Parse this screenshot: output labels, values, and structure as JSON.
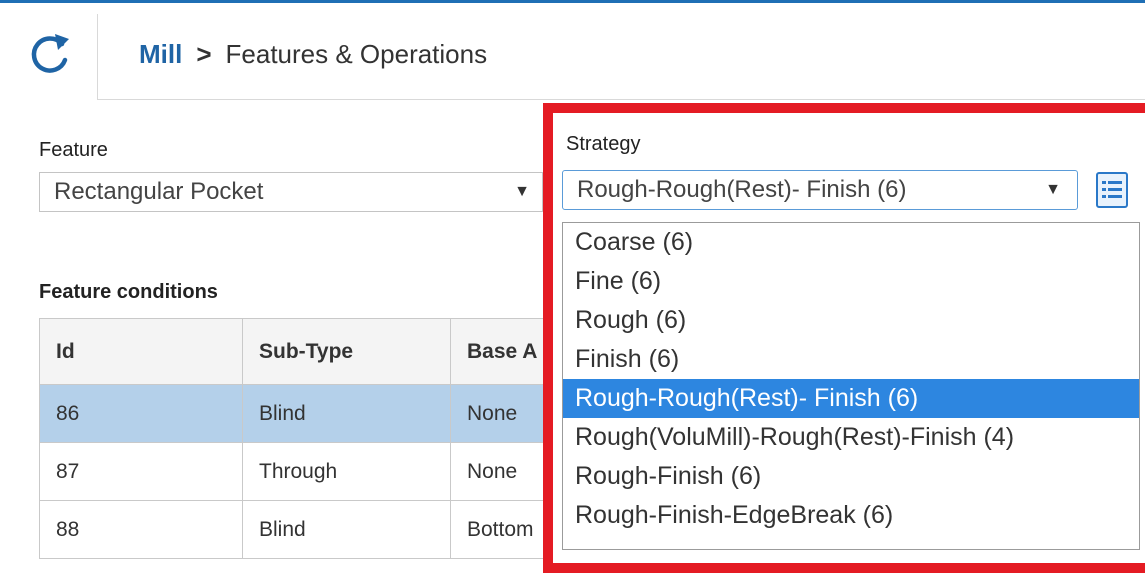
{
  "header": {
    "app": "Mill",
    "separator": ">",
    "page": "Features & Operations"
  },
  "feature": {
    "label": "Feature",
    "selected": "Rectangular Pocket"
  },
  "strategy": {
    "label": "Strategy",
    "selected": "Rough-Rough(Rest)- Finish (6)",
    "options": [
      "Coarse (6)",
      "Fine (6)",
      "Rough (6)",
      "Finish (6)",
      "Rough-Rough(Rest)- Finish (6)",
      "Rough(VoluMill)-Rough(Rest)-Finish (4)",
      "Rough-Finish (6)",
      "Rough-Finish-EdgeBreak (6)"
    ]
  },
  "conditions": {
    "label": "Feature conditions",
    "columns": [
      "Id",
      "Sub-Type",
      "Base A"
    ],
    "rows": [
      [
        "86",
        "Blind",
        "None"
      ],
      [
        "87",
        "Through",
        "None"
      ],
      [
        "88",
        "Blind",
        "Bottom"
      ]
    ]
  },
  "colors": {
    "accent": "#1f64a5",
    "highlight_box": "#e41b23",
    "selected_option": "#2d86e0",
    "selected_row": "#b4d0ea"
  },
  "icons": [
    "refresh-icon",
    "dropdown-arrow-icon",
    "list-view-icon"
  ]
}
